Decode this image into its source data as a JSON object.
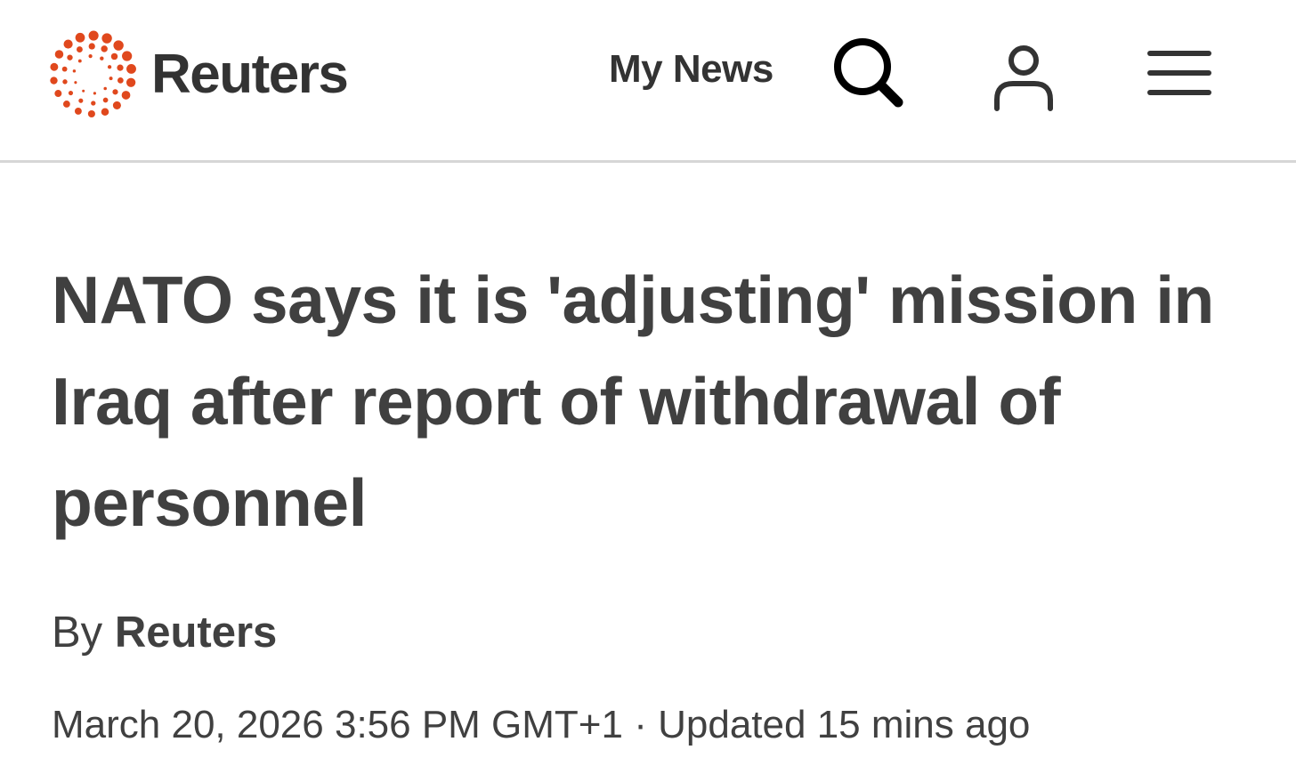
{
  "header": {
    "logo_text": "Reuters",
    "my_news_label": "My News",
    "search_icon": "search-icon",
    "account_icon": "account-icon",
    "menu_icon": "hamburger-menu-icon",
    "brand_color": "#e0481d"
  },
  "article": {
    "headline": "NATO says it is 'adjusting' mission in Iraq after report of withdrawal of personnel",
    "byline_prefix": "By",
    "author": "Reuters",
    "published": "March 20, 2026 3:56 PM GMT+1",
    "separator": "·",
    "updated": "Updated 15 mins ago"
  }
}
